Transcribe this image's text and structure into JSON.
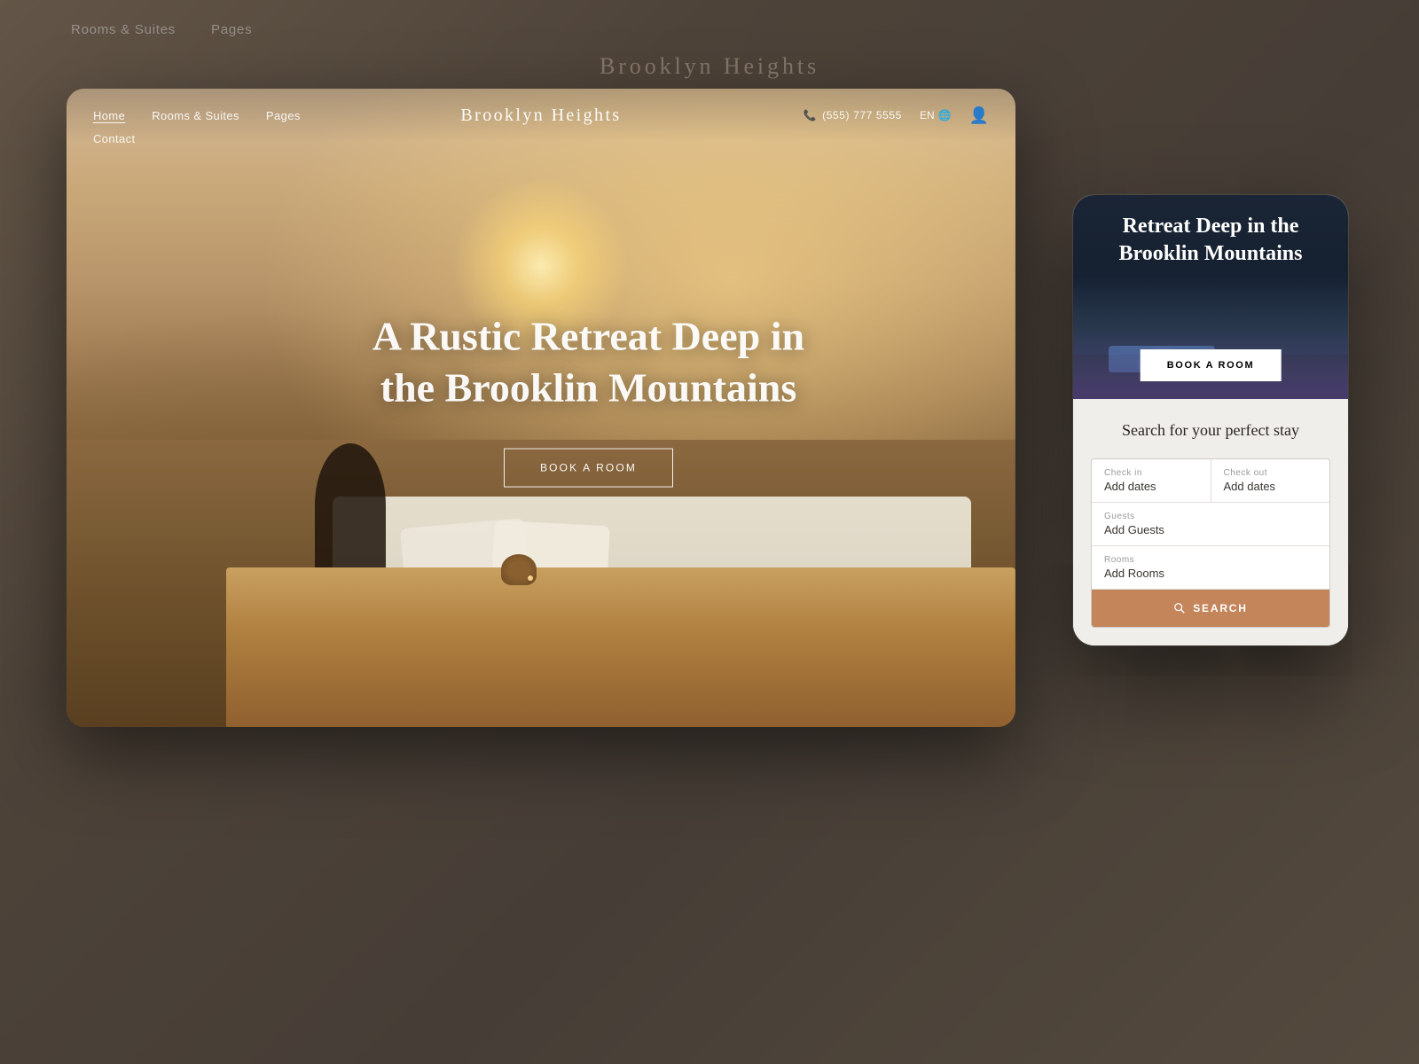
{
  "background": {
    "nav_items": [
      "Rooms & Suites",
      "Pages"
    ],
    "title": "Brooklyn Heights"
  },
  "desktop": {
    "nav": {
      "links": [
        {
          "label": "Home",
          "active": true
        },
        {
          "label": "Rooms & Suites",
          "active": false
        },
        {
          "label": "Pages",
          "active": false
        }
      ],
      "contact_label": "Contact",
      "brand": "Brooklyn Heights",
      "phone_icon": "📞",
      "phone": "(555) 777 5555",
      "lang": "EN",
      "globe_icon": "🌐",
      "user_icon": "👤"
    },
    "hero": {
      "headline": "A Rustic Retreat Deep in the Brooklin Mountains",
      "cta_label": "BOOK A ROOM"
    }
  },
  "mobile": {
    "hero": {
      "title": "Retreat Deep in the Brooklin Mountains",
      "cta_label": "BOOK A ROOM"
    },
    "search": {
      "title": "Search for your perfect stay",
      "checkin_label": "Check in",
      "checkin_placeholder": "Add dates",
      "checkout_label": "Check out",
      "checkout_placeholder": "Add dates",
      "guests_label": "Guests",
      "guests_placeholder": "Add Guests",
      "rooms_label": "Rooms",
      "rooms_placeholder": "Add Rooms",
      "search_label": "SEARCH",
      "search_icon": "🔍"
    }
  }
}
